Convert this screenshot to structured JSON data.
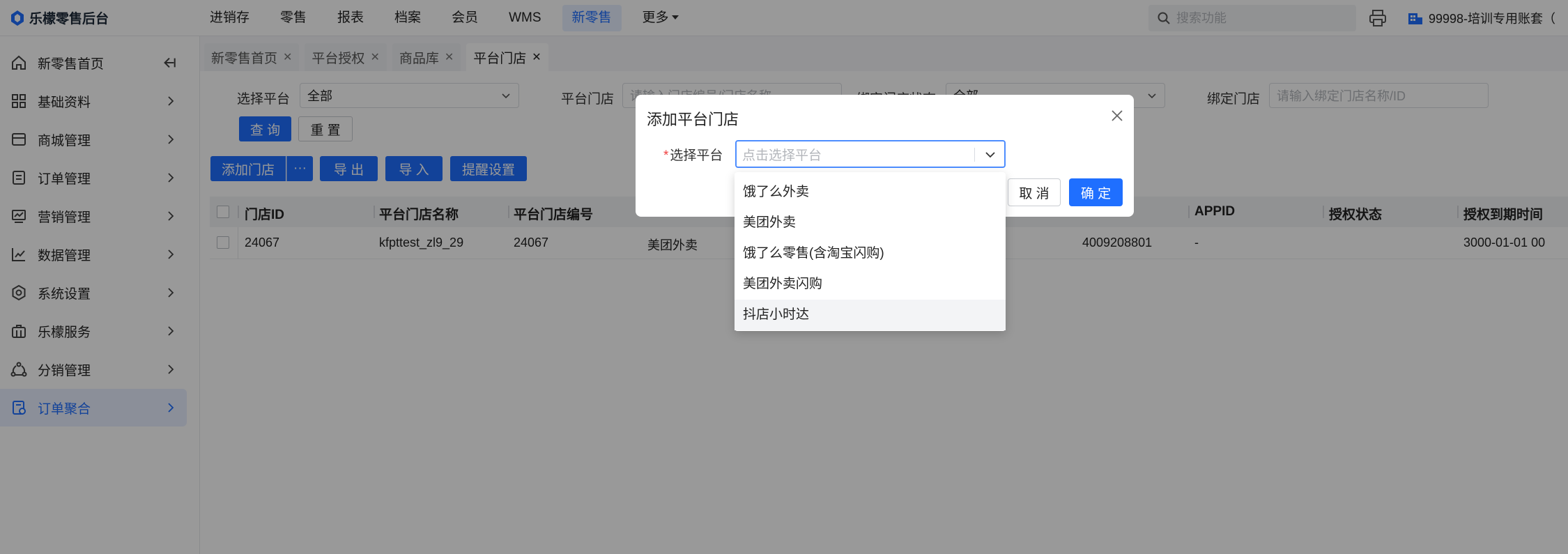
{
  "app": {
    "title": "乐檬零售后台"
  },
  "topnav": {
    "items": [
      "进销存",
      "零售",
      "报表",
      "档案",
      "会员",
      "WMS",
      "新零售"
    ],
    "active": "新零售",
    "more": "更多"
  },
  "search": {
    "placeholder": "搜索功能"
  },
  "account": {
    "label": "99998-培训专用账套（"
  },
  "sidebar": {
    "items": [
      {
        "label": "新零售首页",
        "icon": "home-icon"
      },
      {
        "label": "基础资料",
        "icon": "grid-icon"
      },
      {
        "label": "商城管理",
        "icon": "store-icon"
      },
      {
        "label": "订单管理",
        "icon": "document-icon"
      },
      {
        "label": "营销管理",
        "icon": "marketing-icon"
      },
      {
        "label": "数据管理",
        "icon": "chart-icon"
      },
      {
        "label": "系统设置",
        "icon": "settings-icon"
      },
      {
        "label": "乐檬服务",
        "icon": "briefcase-icon"
      },
      {
        "label": "分销管理",
        "icon": "share-icon"
      },
      {
        "label": "订单聚合",
        "icon": "order-aggregate-icon"
      }
    ],
    "active": "订单聚合"
  },
  "tabs": [
    {
      "label": "新零售首页"
    },
    {
      "label": "平台授权"
    },
    {
      "label": "商品库"
    },
    {
      "label": "平台门店"
    }
  ],
  "filters": {
    "platform_label": "选择平台",
    "platform_value": "全部",
    "store_label": "平台门店",
    "store_placeholder": "请输入门店编号/门店名称",
    "bind_status_label": "绑定门店状态",
    "bind_status_value": "全部",
    "bind_store_label": "绑定门店",
    "bind_store_placeholder": "请输入绑定门店名称/ID"
  },
  "buttons": {
    "query": "查 询",
    "reset": "重 置",
    "add_store": "添加门店",
    "more": "···",
    "export": "导 出",
    "import": "导 入",
    "reminder": "提醒设置"
  },
  "table": {
    "columns": [
      "门店ID",
      "平台门店名称",
      "平台门店编号",
      "",
      "",
      "",
      "APPID",
      "授权状态",
      "授权到期时间"
    ],
    "rows": [
      [
        "24067",
        "kfpttest_zl9_29",
        "24067",
        "美团外卖",
        "",
        "4009208801",
        "-",
        "",
        "3000-01-01 00"
      ]
    ]
  },
  "dialog": {
    "title": "添加平台门店",
    "required_mark": "*",
    "field_label": "选择平台",
    "field_placeholder": "点击选择平台",
    "cancel": "取 消",
    "confirm": "确 定"
  },
  "dropdown": {
    "options": [
      "饿了么外卖",
      "美团外卖",
      "饿了么零售(含淘宝闪购)",
      "美团外卖闪购",
      "抖店小时达"
    ],
    "hovered": "抖店小时达"
  },
  "colors": {
    "primary": "#1f6fff",
    "active_bg": "#e8efff",
    "required": "#f04040"
  }
}
